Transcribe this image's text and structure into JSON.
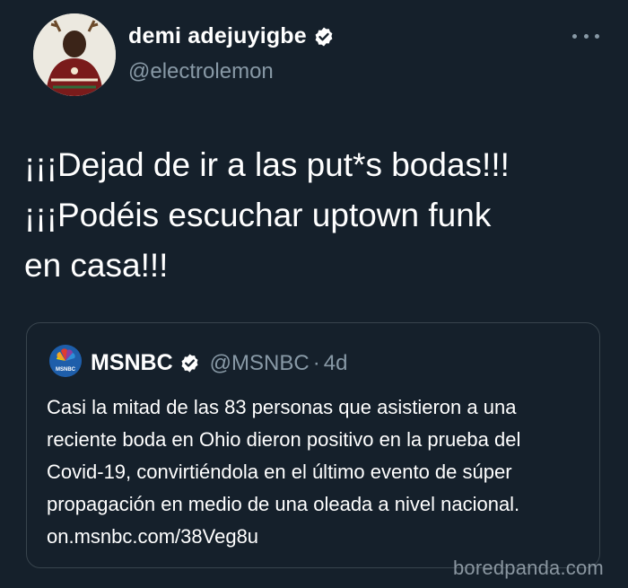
{
  "author": {
    "display_name": "demi adejuyigbe",
    "handle": "@electrolemon"
  },
  "tweet": {
    "lines": [
      "¡¡¡Dejad de ir a las put*s bodas!!!",
      "¡¡¡Podéis escuchar uptown funk",
      "en casa!!!"
    ]
  },
  "quote": {
    "name": "MSNBC",
    "handle": "@MSNBC",
    "separator": "·",
    "age": "4d",
    "logo_text": "MSNBC",
    "lines": [
      "Casi la mitad de las 83 personas que asistieron a una",
      "reciente boda en Ohio dieron positivo en la prueba del",
      "Covid-19, convirtiéndola en el último evento de súper",
      "propagación en medio de una oleada a nivel nacional.",
      "on.msnbc.com/38Veg8u"
    ]
  },
  "watermark": "boredpanda.com",
  "colors": {
    "background": "#15202b",
    "secondary_text": "#8899a6",
    "border": "#38444d",
    "verified_badge": "#ffffff"
  },
  "icons": {
    "verified": "verified-badge-icon",
    "more": "more-options-icon"
  }
}
